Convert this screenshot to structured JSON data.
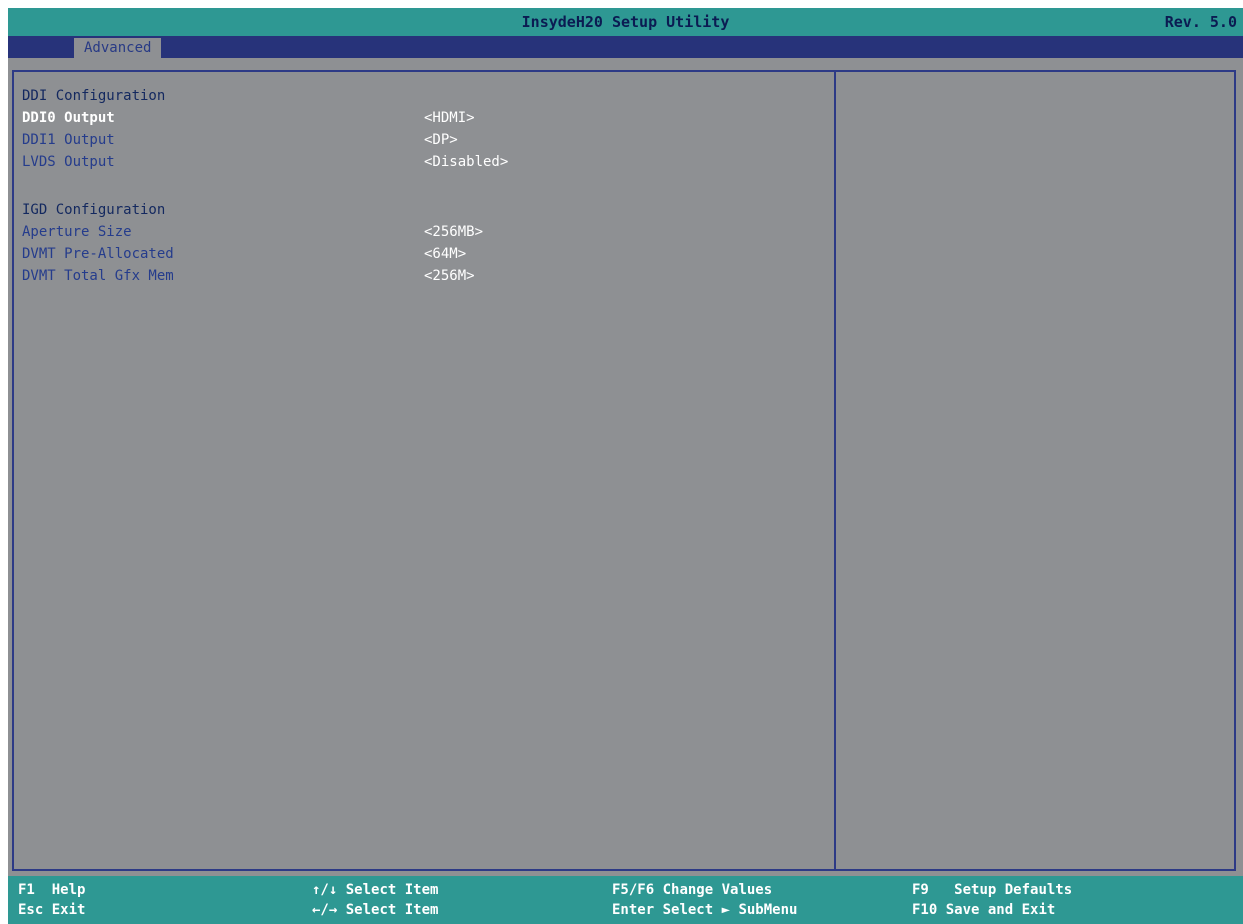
{
  "header": {
    "title": "InsydeH20 Setup Utility",
    "revision": "Rev. 5.0"
  },
  "tabs": [
    {
      "label": "Advanced"
    }
  ],
  "main": {
    "sections": [
      {
        "heading": "DDI Configuration",
        "items": [
          {
            "label": "DDI0 Output",
            "value": "<HDMI>",
            "selected": true
          },
          {
            "label": "DDI1 Output",
            "value": "<DP>",
            "selected": false
          },
          {
            "label": "LVDS Output",
            "value": "<Disabled>",
            "selected": false
          }
        ]
      },
      {
        "heading": "IGD Configuration",
        "items": [
          {
            "label": "Aperture Size",
            "value": "<256MB>",
            "selected": false
          },
          {
            "label": "DVMT Pre-Allocated",
            "value": "<64M>",
            "selected": false
          },
          {
            "label": "DVMT Total Gfx Mem",
            "value": "<256M>",
            "selected": false
          }
        ]
      }
    ]
  },
  "footer": {
    "keys": [
      {
        "key": "F1",
        "desc": "Help"
      },
      {
        "key": "Esc",
        "desc": "Exit"
      },
      {
        "key": "↑/↓",
        "desc": "Select Item"
      },
      {
        "key": "←/→",
        "desc": "Select Item"
      },
      {
        "key": "F5/F6",
        "desc": "Change Values"
      },
      {
        "key": "Enter",
        "desc": "Select ► SubMenu"
      },
      {
        "key": "F9",
        "desc": "Setup Defaults"
      },
      {
        "key": "F10",
        "desc": "Save and Exit"
      }
    ]
  },
  "colors": {
    "background": "#8e9093",
    "header_bar": "#2e9893",
    "tab_bar": "#27337a",
    "item_label": "#253c8c",
    "selected_label": "#ffffff",
    "value_text": "#ffffff"
  }
}
